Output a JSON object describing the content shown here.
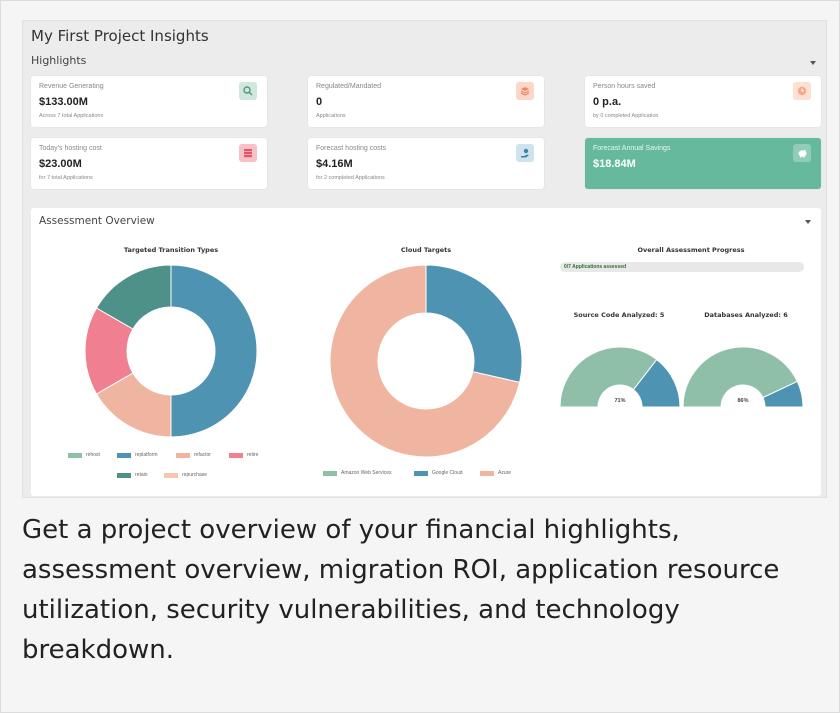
{
  "header": {
    "title": "My First Project Insights"
  },
  "highlights": {
    "title": "Highlights",
    "cards": [
      {
        "label": "Revenue Generating",
        "value": "$133.00M",
        "sub": "Across 7 total Applications",
        "icon": "magnifier-dollar-icon"
      },
      {
        "label": "Regulated/Mandated",
        "value": "0",
        "sub": "Applications",
        "icon": "stack-icon"
      },
      {
        "label": "Person hours saved",
        "value": "0 p.a.",
        "sub": "by 0 completed Application",
        "icon": "clock-icon"
      },
      {
        "label": "Today's hosting cost",
        "value": "$23.00M",
        "sub": "for 7 total Applications",
        "icon": "server-icon"
      },
      {
        "label": "Forecast hosting costs",
        "value": "$4.16M",
        "sub": "for 2 completed Applications",
        "icon": "hand-dollar-icon"
      },
      {
        "label": "Forecast Annual Savings",
        "value": "$18.84M",
        "sub": "",
        "icon": "piggy-bank-icon"
      }
    ]
  },
  "assessment": {
    "title": "Assessment Overview",
    "progress": {
      "title": "Overall Assessment Progress",
      "text": "0/7 Applications assessed",
      "fraction": 0
    },
    "source_code": {
      "title": "Source Code Analyzed: 5",
      "value": "71%",
      "percent": 71
    },
    "databases": {
      "title": "Databases Analyzed: 6",
      "value": "86%",
      "percent": 86
    }
  },
  "colors": {
    "rehost": "#8fbfa8",
    "replatform": "#4f93b3",
    "refactor": "#f0b5a0",
    "retire": "#f08091",
    "retain": "#4e9189",
    "repurchase": "#f5c7ad",
    "aws": "#8fbfa8",
    "google": "#4f93b3",
    "azure": "#f0b5a0"
  },
  "chart_data": [
    {
      "type": "pie",
      "title": "Targeted Transition Types",
      "categories": [
        "rehost",
        "replatform",
        "refactor",
        "retire",
        "retain",
        "repurchase"
      ],
      "values": [
        0,
        3,
        1,
        1,
        1,
        0
      ]
    },
    {
      "type": "pie",
      "title": "Cloud Targets",
      "categories": [
        "Amazon Web Services",
        "Google Cloud",
        "Azure"
      ],
      "values": [
        0,
        2,
        5
      ]
    }
  ],
  "caption": "Get a project overview of your financial highlights, assessment overview, migration ROI, application resource utilization, security vulnerabilities, and technology breakdown."
}
